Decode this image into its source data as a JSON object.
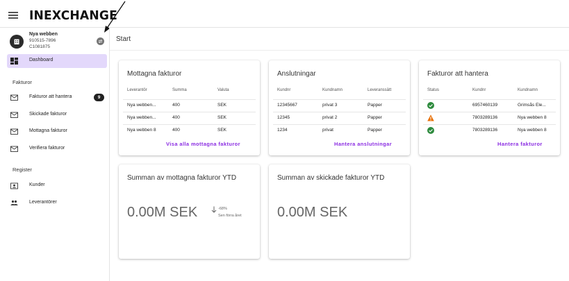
{
  "header": {
    "logo": "INEXCHANGE"
  },
  "company": {
    "name": "Nya webben",
    "org_number": "910515-7896",
    "customer_id": "C1081875"
  },
  "nav": {
    "dashboard": "Dashboard",
    "section_fakturor": "Fakturor",
    "fakturor_att_hantera": "Fakturor att hantera",
    "fakturor_badge": "9",
    "skickade": "Skickade fakturor",
    "mottagna": "Mottagna fakturor",
    "verifiera": "Verifiera fakturor",
    "section_register": "Register",
    "kunder": "Kunder",
    "leverantorer": "Leverantörer"
  },
  "page": {
    "title": "Start"
  },
  "received_card": {
    "title": "Mottagna fakturor",
    "headers": [
      "Leverantör",
      "Summa",
      "Valuta"
    ],
    "rows": [
      [
        "Nya webben...",
        "400",
        "SEK"
      ],
      [
        "Nya webben...",
        "400",
        "SEK"
      ],
      [
        "Nya webben 8",
        "400",
        "SEK"
      ]
    ],
    "link": "Visa alla mottagna fakturor"
  },
  "connections_card": {
    "title": "Anslutningar",
    "headers": [
      "Kundnr",
      "Kundnamn",
      "Leveranssätt"
    ],
    "rows": [
      [
        "12345667",
        "privat 3",
        "Papper"
      ],
      [
        "12345",
        "privat 2",
        "Papper"
      ],
      [
        "1234",
        "privat",
        "Papper"
      ]
    ],
    "link": "Hantera anslutningar"
  },
  "handle_card": {
    "title": "Fakturor att hantera",
    "headers": [
      "Status",
      "Kundnr",
      "Kundnamn"
    ],
    "rows": [
      {
        "status": "ok",
        "kundnr": "6957460139",
        "kundnamn": "Grimsås Ele..."
      },
      {
        "status": "warning",
        "kundnr": "7803289136",
        "kundnamn": "Nya webben 8"
      },
      {
        "status": "ok",
        "kundnr": "7803289136",
        "kundnamn": "Nya webben 8"
      }
    ],
    "link": "Hantera fakturor"
  },
  "ytd_received": {
    "title": "Summan av mottagna fakturor YTD",
    "value": "0.00M SEK",
    "trend_pct": "-68%",
    "trend_label": "Sen förra året"
  },
  "ytd_sent": {
    "title": "Summan av skickade fakturor YTD",
    "value": "0.00M SEK"
  },
  "colors": {
    "accent": "#8a2be2",
    "active_nav": "#e3d8fb",
    "ok": "#2e8b3e",
    "warning": "#e8710a"
  }
}
